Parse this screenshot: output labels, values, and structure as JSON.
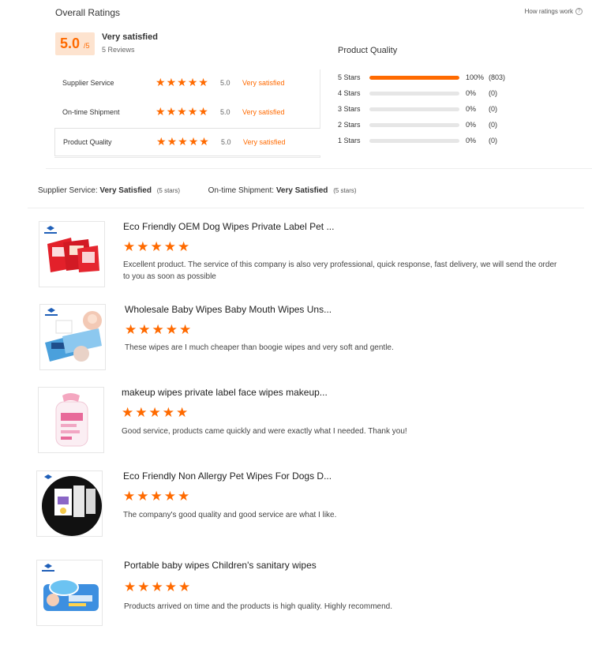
{
  "header": {
    "title": "Overall Ratings",
    "how_link": "How ratings work",
    "how_icon": "question-circle-icon"
  },
  "overall": {
    "score": "5.0",
    "max": "/5",
    "label": "Very satisfied",
    "reviews": "5 Reviews"
  },
  "categories": [
    {
      "name": "Supplier Service",
      "stars": 5,
      "score": "5.0",
      "label": "Very satisfied"
    },
    {
      "name": "On-time Shipment",
      "stars": 5,
      "score": "5.0",
      "label": "Very satisfied"
    },
    {
      "name": "Product Quality",
      "stars": 5,
      "score": "5.0",
      "label": "Very satisfied"
    }
  ],
  "product_quality": {
    "title": "Product Quality",
    "distribution": [
      {
        "label": "5 Stars",
        "fraction": 1.0,
        "percent": "100%",
        "count": "(803)"
      },
      {
        "label": "4 Stars",
        "fraction": 0.0,
        "percent": "0%",
        "count": "(0)"
      },
      {
        "label": "3 Stars",
        "fraction": 0.0,
        "percent": "0%",
        "count": "(0)"
      },
      {
        "label": "2 Stars",
        "fraction": 0.0,
        "percent": "0%",
        "count": "(0)"
      },
      {
        "label": "1 Stars",
        "fraction": 0.0,
        "percent": "0%",
        "count": "(0)"
      }
    ]
  },
  "summary": {
    "supplier_label": "Supplier Service:",
    "supplier_value": "Very Satisfied",
    "supplier_stars": "(5 stars)",
    "shipment_label": "On-time Shipment:",
    "shipment_value": "Very Satisfied",
    "shipment_stars": "(5 stars)"
  },
  "colors": {
    "accent": "#ff6a00",
    "score_bg": "#fde3cf"
  },
  "reviews": [
    {
      "title": "Eco Friendly OEM Dog Wipes Private Label Pet ...",
      "stars": 5,
      "text": "Excellent product. The service of this company is also very professional, quick response, fast delivery, we will send the order to you as soon as possible"
    },
    {
      "title": "Wholesale Baby Wipes Baby Mouth Wipes Uns...",
      "stars": 5,
      "text": "These wipes are I much cheaper than boogie wipes and very soft and gentle."
    },
    {
      "title": "makeup wipes private label face wipes makeup...",
      "stars": 5,
      "text": "Good service, products came quickly and were exactly what I needed. Thank you!"
    },
    {
      "title": "Eco Friendly Non Allergy Pet Wipes For Dogs D...",
      "stars": 5,
      "text": "The company's good quality and good service are what I like."
    },
    {
      "title": "Portable baby wipes Children's sanitary wipes",
      "stars": 5,
      "text": "Products arrived on time and the products is high quality. Highly recommend."
    }
  ]
}
